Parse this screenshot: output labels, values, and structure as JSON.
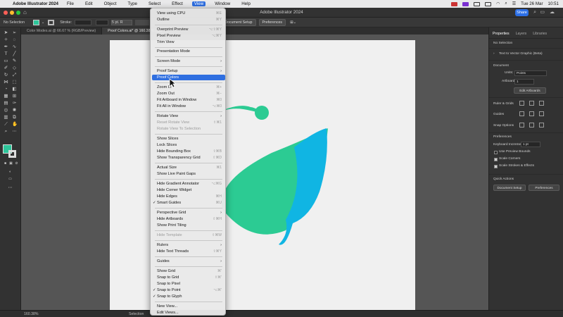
{
  "menubar": {
    "app": "Adobe Illustrator 2024",
    "items": [
      "File",
      "Edit",
      "Object",
      "Type",
      "Select",
      "Effect",
      "View",
      "Window",
      "Help"
    ],
    "date": "Tue 26 Mar",
    "time": "10:51"
  },
  "window": {
    "title": "Adobe Illustrator 2024",
    "share": "Share"
  },
  "control": {
    "selection": "No Selection",
    "stroke_label": "Stroke:",
    "stroke_value": "",
    "pt_value": "5 pt. R",
    "document_setup": "Document Setup",
    "preferences": "Preferences"
  },
  "tabs": [
    "Color Modes.ai @ 66.67 % (RGB/Preview)",
    "Proof Colors.ai* @ 160.38 % (RG"
  ],
  "status": {
    "zoom": "160.38%",
    "tool": "Selection"
  },
  "view_menu": {
    "items": [
      {
        "label": "View using CPU",
        "shortcut": "⌘E"
      },
      {
        "label": "Outline",
        "shortcut": "⌘Y"
      },
      {
        "label": "Overprint Preview",
        "shortcut": "⌥⇧⌘Y"
      },
      {
        "label": "Pixel Preview",
        "shortcut": "⌥⌘Y"
      },
      {
        "label": "Trim View",
        "shortcut": ""
      },
      {
        "label": "Presentation Mode",
        "shortcut": ""
      },
      {
        "label": "Screen Mode",
        "shortcut": ""
      },
      {
        "label": "Proof Setup",
        "shortcut": ""
      },
      {
        "label": "Proof Colors",
        "shortcut": ""
      },
      {
        "label": "Zoom In",
        "shortcut": "⌘+"
      },
      {
        "label": "Zoom Out",
        "shortcut": "⌘−"
      },
      {
        "label": "Fit Artboard in Window",
        "shortcut": "⌘0"
      },
      {
        "label": "Fit All in Window",
        "shortcut": "⌥⌘0"
      },
      {
        "label": "Rotate View",
        "shortcut": ""
      },
      {
        "label": "Reset Rotate View",
        "shortcut": "⇧⌘1"
      },
      {
        "label": "Rotate View To Selection",
        "shortcut": ""
      },
      {
        "label": "Show Slices",
        "shortcut": ""
      },
      {
        "label": "Lock Slices",
        "shortcut": ""
      },
      {
        "label": "Hide Bounding Box",
        "shortcut": "⇧⌘B"
      },
      {
        "label": "Show Transparency Grid",
        "shortcut": "⇧⌘D"
      },
      {
        "label": "Actual Size",
        "shortcut": "⌘1"
      },
      {
        "label": "Show Live Paint Gaps",
        "shortcut": ""
      },
      {
        "label": "Hide Gradient Annotator",
        "shortcut": "⌥⌘G"
      },
      {
        "label": "Hide Corner Widget",
        "shortcut": ""
      },
      {
        "label": "Hide Edges",
        "shortcut": "⌘H"
      },
      {
        "label": "Smart Guides",
        "shortcut": "⌘U"
      },
      {
        "label": "Perspective Grid",
        "shortcut": ""
      },
      {
        "label": "Hide Artboards",
        "shortcut": "⇧⌘H"
      },
      {
        "label": "Show Print Tiling",
        "shortcut": ""
      },
      {
        "label": "Hide Template",
        "shortcut": "⇧⌘W"
      },
      {
        "label": "Rulers",
        "shortcut": ""
      },
      {
        "label": "Hide Text Threads",
        "shortcut": "⇧⌘Y"
      },
      {
        "label": "Guides",
        "shortcut": ""
      },
      {
        "label": "Show Grid",
        "shortcut": "⌘'"
      },
      {
        "label": "Snap to Grid",
        "shortcut": "⇧⌘'"
      },
      {
        "label": "Snap to Pixel",
        "shortcut": ""
      },
      {
        "label": "Snap to Point",
        "shortcut": "⌥⌘'"
      },
      {
        "label": "Snap to Glyph",
        "shortcut": ""
      },
      {
        "label": "New View...",
        "shortcut": ""
      },
      {
        "label": "Edit Views...",
        "shortcut": ""
      }
    ]
  },
  "properties": {
    "tabs": [
      "Properties",
      "Layers",
      "Libraries"
    ],
    "selection": "No Selection",
    "text_to_vector": "Text to Vector Graphic (Beta)",
    "document_header": "Document",
    "units_label": "Units:",
    "units_value": "Points",
    "artboard_label": "Artboard:",
    "artboard_value": "1",
    "edit_artboards": "Edit Artboards",
    "rulers_grids": "Ruler & Grids",
    "guides": "Guides",
    "snap_options": "Snap Options",
    "preferences_header": "Preferences",
    "keyboard_increment_label": "Keyboard Increment:",
    "keyboard_increment_value": "1 pt",
    "use_preview_bounds": "Use Preview Bounds",
    "scale_corners": "Scale Corners",
    "scale_strokes": "Scale Strokes & Effects",
    "quick_actions": "Quick Actions",
    "document_setup": "Document Setup",
    "preferences": "Preferences"
  },
  "colors": {
    "accent": "#2f6fe0",
    "art_green": "#2ccb93",
    "art_blue": "#10b5e3",
    "fill_swatch": "#2dc59a"
  }
}
